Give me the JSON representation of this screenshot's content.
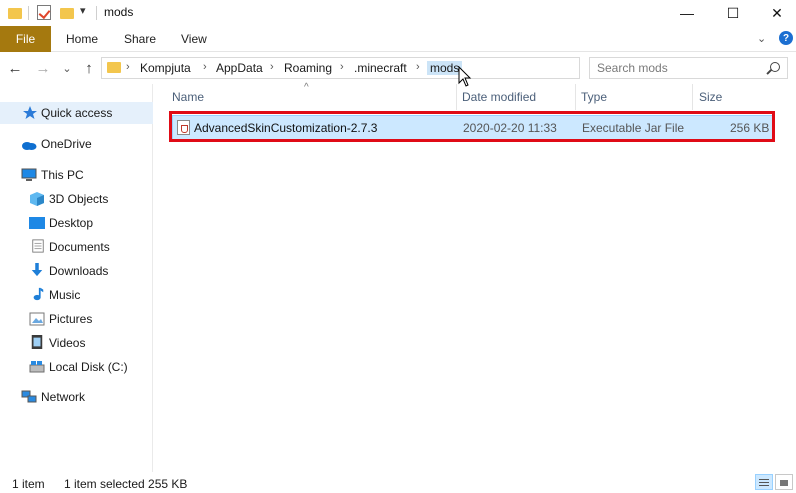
{
  "window": {
    "title": "mods",
    "controls": {
      "minimize": "—",
      "maximize": "☐",
      "close": "✕"
    }
  },
  "ribbon": {
    "tabs": [
      "File",
      "Home",
      "Share",
      "View"
    ],
    "help": "?",
    "collapse": "⌄"
  },
  "navigation": {
    "back": "←",
    "forward": "→",
    "recent": "⌄",
    "up": "↑",
    "breadcrumbs": [
      "Kompjuta",
      "AppData",
      "Roaming",
      ".minecraft",
      "mods"
    ],
    "separator": "›",
    "dropdown": "⌄",
    "refresh": "↻",
    "search_placeholder": "Search mods"
  },
  "sidebar": {
    "quick_access": "Quick access",
    "onedrive": "OneDrive",
    "this_pc": "This PC",
    "items": [
      "3D Objects",
      "Desktop",
      "Documents",
      "Downloads",
      "Music",
      "Pictures",
      "Videos",
      "Local Disk (C:)"
    ],
    "network": "Network"
  },
  "file_list": {
    "columns": [
      "Name",
      "Date modified",
      "Type",
      "Size"
    ],
    "rows": [
      {
        "name": "AdvancedSkinCustomization-2.7.3",
        "date": "2020-02-20 11:33",
        "type": "Executable Jar File",
        "size": "256 KB"
      }
    ]
  },
  "status": {
    "count": "1 item",
    "selection": "1 item selected  255 KB"
  },
  "colors": {
    "file_tab": "#a5790f",
    "selection": "#cce8ff",
    "highlight_border": "#e00b16",
    "folder": "#f3c64d"
  }
}
